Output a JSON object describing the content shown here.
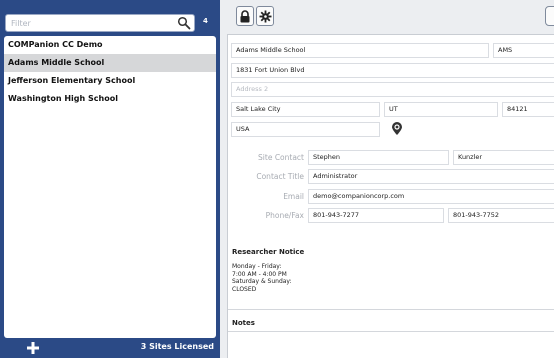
{
  "filter": {
    "placeholder": "Filter",
    "count": "4"
  },
  "sites": [
    {
      "name": "COMPanion CC Demo",
      "selected": false
    },
    {
      "name": "Adams Middle School",
      "selected": true
    },
    {
      "name": "Jefferson Elementary School",
      "selected": false
    },
    {
      "name": "Washington High School",
      "selected": false
    }
  ],
  "footer": {
    "licensed": "3 Sites Licensed",
    "add_icon": "plus-icon"
  },
  "toolbar": {
    "lock_icon": "lock-icon",
    "gear_icon": "gear-icon"
  },
  "detail": {
    "school_name": "Adams Middle School",
    "abbreviation": "AMS",
    "address1": "1831 Fort Union Blvd",
    "address2_placeholder": "Address 2",
    "city": "Salt Lake City",
    "state": "UT",
    "zip": "84121",
    "country": "USA",
    "site_contact_label": "Site Contact",
    "contact_first": "Stephen",
    "contact_last": "Kunzler",
    "contact_title_label": "Contact Title",
    "contact_title": "Administrator",
    "email_label": "Email",
    "email": "demo@companioncorp.com",
    "phone_label": "Phone/Fax",
    "phone": "801-943-7277",
    "fax": "801-943-7752",
    "researcher_notice_title": "Researcher Notice",
    "researcher_notice": "Monday - Friday:\n7:00 AM - 4:00 PM\nSaturday & Sunday:\nCLOSED",
    "notes_title": "Notes"
  },
  "colors": {
    "sidebar": "#2b4a86",
    "selected_row": "#d6d7d9",
    "background": "#eceef1"
  }
}
